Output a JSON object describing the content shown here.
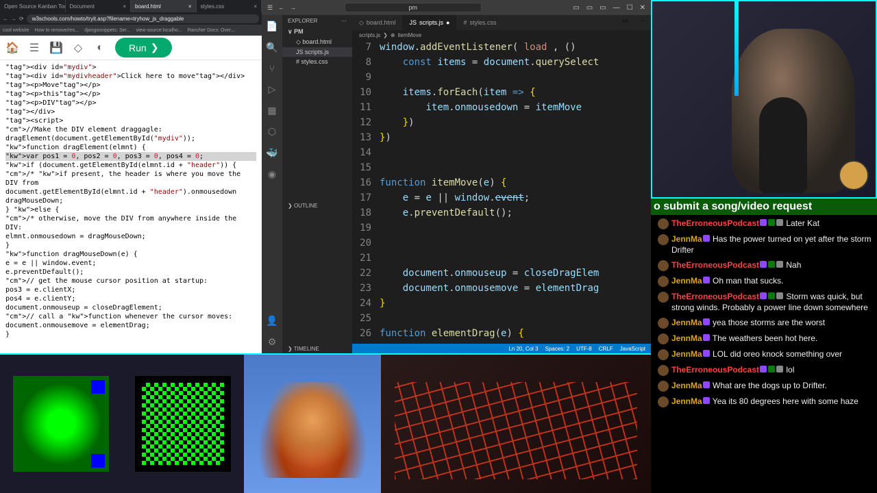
{
  "browser": {
    "tabs": [
      {
        "label": "Open Source Kanban Too"
      },
      {
        "label": "Document"
      },
      {
        "label": "board.html"
      },
      {
        "label": "styles.css"
      }
    ],
    "url": "w3schools.com/howto/tryit.asp?filename=tryhow_js_draggable",
    "bookmarks": [
      "cool website",
      "How to remove/res...",
      "djangosnippets: Ser...",
      "view-source:localho...",
      "Rancher Docs: Over..."
    ],
    "run_label": "Run",
    "code_lines": [
      "<div id=\"mydiv\">",
      "  <div id=\"mydivheader\">Click here to move</div>",
      "  <p>Move</p>",
      "  <p>this</p>",
      "  <p>DIV</p>",
      "</div>",
      "",
      "<script>",
      "//Make the DIV element draggagle:",
      "dragElement(document.getElementById(\"mydiv\"));",
      "",
      "function dragElement(elmnt) {",
      "  var pos1 = 0, pos2 = 0, pos3 = 0, pos4 = 0;",
      "  if (document.getElementById(elmnt.id + \"header\")) {",
      "    /* if present, the header is where you move the DIV from",
      "    document.getElementById(elmnt.id + \"header\").onmousedown",
      "dragMouseDown;",
      "  } else {",
      "    /* otherwise, move the DIV from anywhere inside the DIV:",
      "    elmnt.onmousedown = dragMouseDown;",
      "  }",
      "",
      "  function dragMouseDown(e) {",
      "    e = e || window.event;",
      "    e.preventDefault();",
      "    // get the mouse cursor position at startup:",
      "    pos3 = e.clientX;",
      "    pos4 = e.clientY;",
      "    document.onmouseup = closeDragElement;",
      "    // call a function whenever the cursor moves:",
      "    document.onmousemove = elementDrag;",
      "  }"
    ]
  },
  "vscode": {
    "search_placeholder": "pm",
    "explorer_label": "EXPLORER",
    "folder": "PM",
    "files": [
      "board.html",
      "scripts.js",
      "styles.css"
    ],
    "outline": "OUTLINE",
    "timeline": "TIMELINE",
    "tabs": [
      "board.html",
      "scripts.js",
      "styles.css"
    ],
    "breadcrumb_a": "scripts.js",
    "breadcrumb_b": "itemMove",
    "gutter_start": 7,
    "status": {
      "pos": "Ln 20, Col 3",
      "spaces": "Spaces: 2",
      "enc": "UTF-8",
      "eol": "CRLF",
      "lang": "JavaScript"
    }
  },
  "stream": {
    "ticker": "o submit a song/video request",
    "chat": [
      {
        "u": "TheErroneousPodcast",
        "c": "ep",
        "badges": [
          "p",
          "g",
          "gr"
        ],
        "t": "Later Kat"
      },
      {
        "u": "JennMa",
        "c": "jm",
        "badges": [
          "p"
        ],
        "t": "Has the power turned on yet after the storm Drifter"
      },
      {
        "u": "TheErroneousPodcast",
        "c": "ep",
        "badges": [
          "p",
          "g",
          "gr"
        ],
        "t": "Nah"
      },
      {
        "u": "JennMa",
        "c": "jm",
        "badges": [
          "p"
        ],
        "t": "Oh man that sucks."
      },
      {
        "u": "TheErroneousPodcast",
        "c": "ep",
        "badges": [
          "p",
          "g",
          "gr"
        ],
        "t": "Storm was quick, but strong winds. Probably a power line down somewhere"
      },
      {
        "u": "JennMa",
        "c": "jm",
        "badges": [
          "p"
        ],
        "t": "yea those storms are the worst"
      },
      {
        "u": "JennMa",
        "c": "jm",
        "badges": [
          "p"
        ],
        "t": "The weathers been hot here."
      },
      {
        "u": "JennMa",
        "c": "jm",
        "badges": [
          "p"
        ],
        "t": "LOL did oreo knock something over"
      },
      {
        "u": "TheErroneousPodcast",
        "c": "ep",
        "badges": [
          "p",
          "g",
          "gr"
        ],
        "t": "lol"
      },
      {
        "u": "JennMa",
        "c": "jm",
        "badges": [
          "p"
        ],
        "t": "What are the dogs up to Drifter."
      },
      {
        "u": "JennMa",
        "c": "jm",
        "badges": [
          "p"
        ],
        "t": "Yea its 80 degrees here with some haze"
      }
    ]
  }
}
